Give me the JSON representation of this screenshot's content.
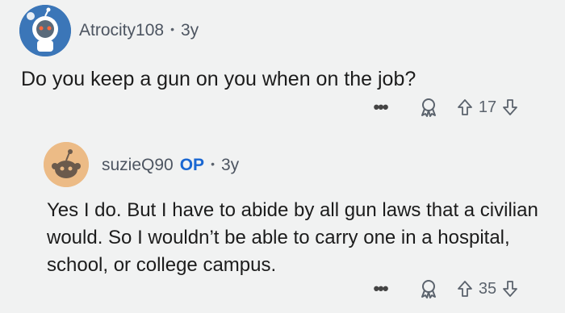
{
  "comments": [
    {
      "author": "Atrocity108",
      "op_badge": "",
      "separator": "•",
      "age": "3y",
      "body": "Do you keep a gun on you when on the job?",
      "more_label": "•••",
      "score": "17",
      "avatar_color": "#3b76b8"
    },
    {
      "author": "suzieQ90",
      "op_badge": "OP",
      "separator": "•",
      "age": "3y",
      "body": "Yes I do. But I have to abide by all gun laws that a civilian would. So I wouldn’t be able to carry one in a hospital, school, or college campus.",
      "more_label": "•••",
      "score": "35",
      "avatar_color": "#ecbb86"
    }
  ],
  "icons": {
    "award": "award-icon",
    "upvote": "upvote-arrow-icon",
    "downvote": "downvote-arrow-icon",
    "more": "more-options-icon"
  }
}
